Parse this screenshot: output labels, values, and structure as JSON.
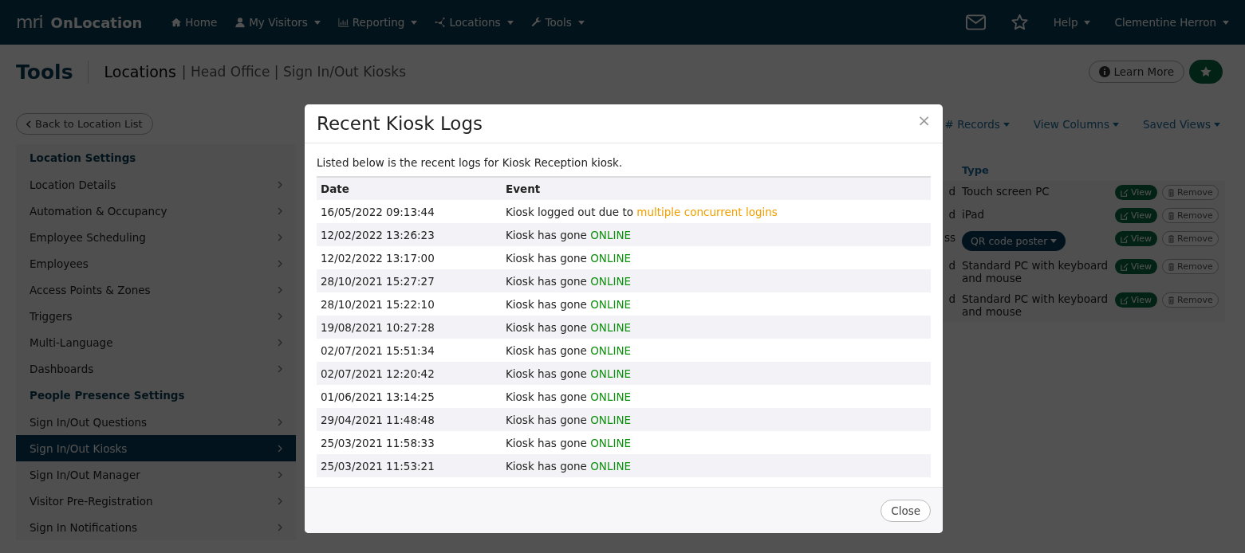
{
  "navbar": {
    "logo_mark": "mri",
    "app_name": "OnLocation",
    "items": [
      {
        "label": "Home",
        "dropdown": false
      },
      {
        "label": "My Visitors",
        "dropdown": true
      },
      {
        "label": "Reporting",
        "dropdown": true
      },
      {
        "label": "Locations",
        "dropdown": true
      },
      {
        "label": "Tools",
        "dropdown": true
      }
    ],
    "help": "Help",
    "user": "Clementine Herron"
  },
  "page_header": {
    "title": "Tools",
    "breadcrumb": "Locations",
    "trail": "| Head Office | Sign In/Out Kiosks",
    "learn_more": "Learn More"
  },
  "back_button": "Back to Location List",
  "sidebar": {
    "sections": [
      {
        "title": "Location Settings",
        "items": [
          {
            "label": "Location Details",
            "selected": false
          },
          {
            "label": "Automation & Occupancy",
            "selected": false
          },
          {
            "label": "Employee Scheduling",
            "selected": false
          },
          {
            "label": "Employees",
            "selected": false
          },
          {
            "label": "Access Points & Zones",
            "selected": false
          },
          {
            "label": "Triggers",
            "selected": false
          },
          {
            "label": "Multi-Language",
            "selected": false
          },
          {
            "label": "Dashboards",
            "selected": false
          }
        ]
      },
      {
        "title": "People Presence Settings",
        "items": [
          {
            "label": "Sign In/Out Questions",
            "selected": false
          },
          {
            "label": "Sign In/Out Kiosks",
            "selected": true
          },
          {
            "label": "Sign In/Out Manager",
            "selected": false
          },
          {
            "label": "Visitor Pre-Registration",
            "selected": false
          },
          {
            "label": "Sign In Notifications",
            "selected": false
          }
        ]
      }
    ]
  },
  "toolbar": [
    "# Records",
    "View Columns",
    "Saved Views"
  ],
  "kiosk_table": {
    "type_heading": "Type",
    "rows": [
      {
        "column_3": "d",
        "type": "Touch screen PC",
        "kind": "text",
        "view": "View",
        "remove": "Remove"
      },
      {
        "column_3": "d",
        "type": "iPad",
        "kind": "text",
        "view": "View",
        "remove": "Remove"
      },
      {
        "column_3": "ss",
        "type": "QR code poster",
        "kind": "dropdown",
        "view": "View",
        "remove": "Remove"
      },
      {
        "column_3": "d",
        "type": "Standard PC with keyboard and mouse",
        "kind": "text",
        "view": "View",
        "remove": "Remove"
      },
      {
        "column_3": "d",
        "type": "Standard PC with keyboard and mouse",
        "kind": "text",
        "view": "View",
        "remove": "Remove"
      }
    ]
  },
  "modal": {
    "title": "Recent Kiosk Logs",
    "close_icon": "×",
    "intro": "Listed below is the recent logs for Kiosk Reception kiosk.",
    "columns": [
      "Date",
      "Event"
    ],
    "rows": [
      {
        "date": "16/05/2022 09:13:44",
        "event": "Kiosk logged out due to ",
        "highlight": "multiple concurrent logins",
        "color": "#f0a000"
      },
      {
        "date": "12/02/2022 13:26:23",
        "event": "Kiosk has gone ",
        "highlight": "ONLINE",
        "color": "#109010"
      },
      {
        "date": "12/02/2022 13:17:00",
        "event": "Kiosk has gone ",
        "highlight": "ONLINE",
        "color": "#109010"
      },
      {
        "date": "28/10/2021 15:27:27",
        "event": "Kiosk has gone ",
        "highlight": "ONLINE",
        "color": "#109010"
      },
      {
        "date": "28/10/2021 15:22:10",
        "event": "Kiosk has gone ",
        "highlight": "ONLINE",
        "color": "#109010"
      },
      {
        "date": "19/08/2021 10:27:28",
        "event": "Kiosk has gone ",
        "highlight": "ONLINE",
        "color": "#109010"
      },
      {
        "date": "02/07/2021 15:51:34",
        "event": "Kiosk has gone ",
        "highlight": "ONLINE",
        "color": "#109010"
      },
      {
        "date": "02/07/2021 12:20:42",
        "event": "Kiosk has gone ",
        "highlight": "ONLINE",
        "color": "#109010"
      },
      {
        "date": "01/06/2021 13:14:25",
        "event": "Kiosk has gone ",
        "highlight": "ONLINE",
        "color": "#109010"
      },
      {
        "date": "29/04/2021 11:48:48",
        "event": "Kiosk has gone ",
        "highlight": "ONLINE",
        "color": "#109010"
      },
      {
        "date": "25/03/2021 11:58:33",
        "event": "Kiosk has gone ",
        "highlight": "ONLINE",
        "color": "#109010"
      },
      {
        "date": "25/03/2021 11:53:21",
        "event": "Kiosk has gone ",
        "highlight": "ONLINE",
        "color": "#109010"
      }
    ],
    "close_button": "Close"
  }
}
